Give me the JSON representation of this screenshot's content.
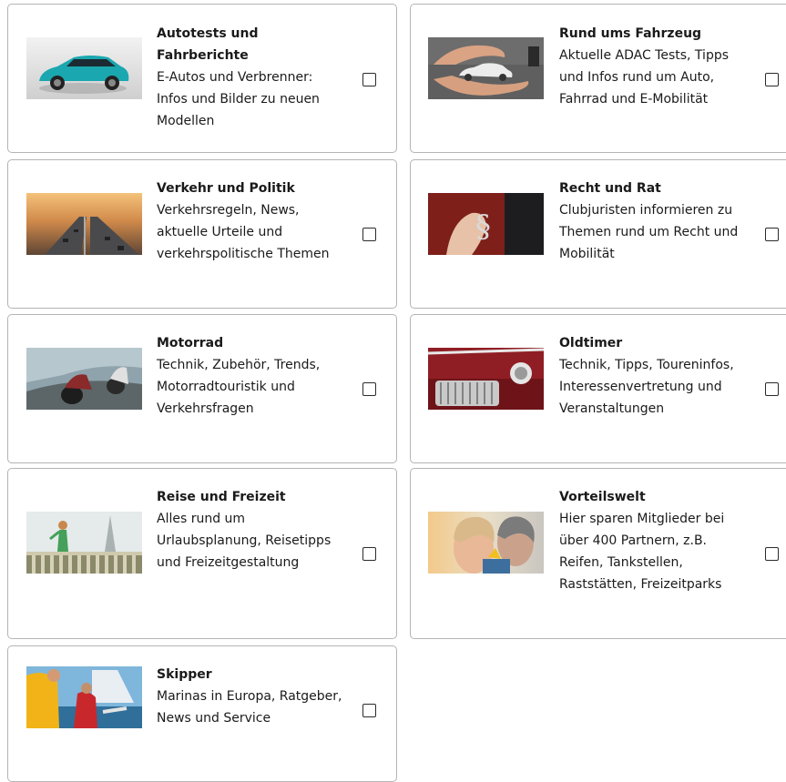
{
  "cards": [
    {
      "title": "Autotests und Fahrberichte",
      "desc": "E-Autos und Verbrenner: Infos und Bilder zu neuen Modellen",
      "checked": false
    },
    {
      "title": "Rund ums Fahrzeug",
      "desc": "Aktuelle ADAC Tests, Tipps und Infos rund um Auto, Fahrrad und E-Mobilität",
      "checked": false
    },
    {
      "title": "Verkehr und Politik",
      "desc": "Verkehrsregeln, News, aktuelle Urteile und verkehrspolitische Themen",
      "checked": false
    },
    {
      "title": "Recht und Rat",
      "desc": "Clubjuristen informieren zu Themen rund um Recht und Mobilität",
      "checked": false
    },
    {
      "title": "Motorrad",
      "desc": "Technik, Zubehör, Trends, Motorradtouristik und Verkehrsfragen",
      "checked": false
    },
    {
      "title": "Oldtimer",
      "desc": "Technik, Tipps, Toureninfos, Interessenvertretung und Veranstaltungen",
      "checked": false
    },
    {
      "title": "Reise und Freizeit",
      "desc": "Alles rund um Urlaubsplanung, Reisetipps und Freizeitgestaltung",
      "checked": false
    },
    {
      "title": "Vorteilswelt",
      "desc": "Hier sparen Mitglieder bei über 400 Partnern, z.B. Reifen, Tankstellen, Raststätten, Freizeitparks",
      "checked": false
    },
    {
      "title": "Skipper",
      "desc": "Marinas in Europa, Ratgeber, News und Service",
      "checked": false
    }
  ]
}
